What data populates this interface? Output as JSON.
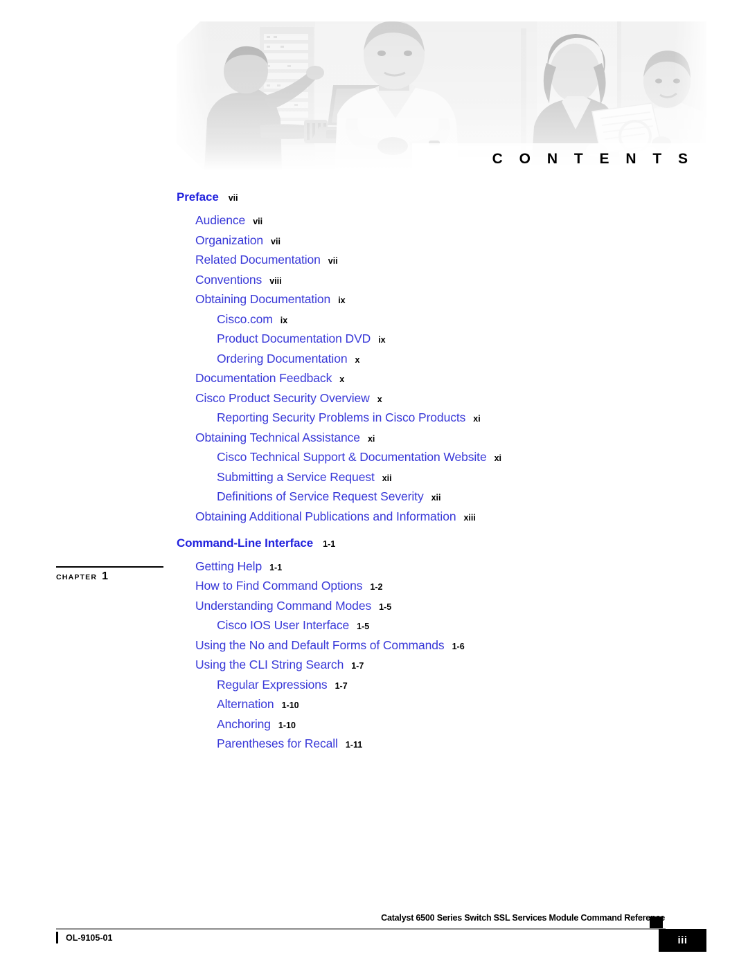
{
  "banner": {
    "alt_name": "cisco-people-networking-banner",
    "contents_title": "C O N T E N T S"
  },
  "toc": {
    "sections": [
      {
        "heading": {
          "label": "Preface",
          "page": "vii"
        },
        "chapter_marker": null,
        "entries": [
          {
            "label": "Audience",
            "page": "vii",
            "level": 1
          },
          {
            "label": "Organization",
            "page": "vii",
            "level": 1
          },
          {
            "label": "Related Documentation",
            "page": "vii",
            "level": 1
          },
          {
            "label": "Conventions",
            "page": "viii",
            "level": 1
          },
          {
            "label": "Obtaining Documentation",
            "page": "ix",
            "level": 1
          },
          {
            "label": "Cisco.com",
            "page": "ix",
            "level": 2
          },
          {
            "label": "Product Documentation DVD",
            "page": "ix",
            "level": 2
          },
          {
            "label": "Ordering Documentation",
            "page": "x",
            "level": 2
          },
          {
            "label": "Documentation Feedback",
            "page": "x",
            "level": 1
          },
          {
            "label": "Cisco Product Security Overview",
            "page": "x",
            "level": 1
          },
          {
            "label": "Reporting Security Problems in Cisco Products",
            "page": "xi",
            "level": 2
          },
          {
            "label": "Obtaining Technical Assistance",
            "page": "xi",
            "level": 1
          },
          {
            "label": "Cisco Technical Support & Documentation Website",
            "page": "xi",
            "level": 2
          },
          {
            "label": "Submitting a Service Request",
            "page": "xii",
            "level": 2
          },
          {
            "label": "Definitions of Service Request Severity",
            "page": "xii",
            "level": 2
          },
          {
            "label": "Obtaining Additional Publications and Information",
            "page": "xiii",
            "level": 1
          }
        ]
      },
      {
        "heading": {
          "label": "Command-Line Interface",
          "page": "1-1"
        },
        "chapter_marker": {
          "word": "CHAPTER",
          "number": "1"
        },
        "entries": [
          {
            "label": "Getting Help",
            "page": "1-1",
            "level": 1
          },
          {
            "label": "How to Find Command Options",
            "page": "1-2",
            "level": 1
          },
          {
            "label": "Understanding Command Modes",
            "page": "1-5",
            "level": 1
          },
          {
            "label": "Cisco IOS User Interface",
            "page": "1-5",
            "level": 2
          },
          {
            "label": "Using the No and Default Forms of Commands",
            "page": "1-6",
            "level": 1
          },
          {
            "label": "Using the CLI String Search",
            "page": "1-7",
            "level": 1
          },
          {
            "label": "Regular Expressions",
            "page": "1-7",
            "level": 2
          },
          {
            "label": "Alternation",
            "page": "1-10",
            "level": 2
          },
          {
            "label": "Anchoring",
            "page": "1-10",
            "level": 2
          },
          {
            "label": "Parentheses for Recall",
            "page": "1-11",
            "level": 2
          }
        ]
      }
    ]
  },
  "footer": {
    "document_title": "Catalyst 6500 Series Switch SSL Services Module Command Reference",
    "document_id": "OL-9105-01",
    "page_number": "iii"
  },
  "colors": {
    "link_blue": "#3838d8",
    "heading_blue": "#2222dd",
    "page_black": "#000000",
    "footer_rule": "#8c8c8c"
  }
}
